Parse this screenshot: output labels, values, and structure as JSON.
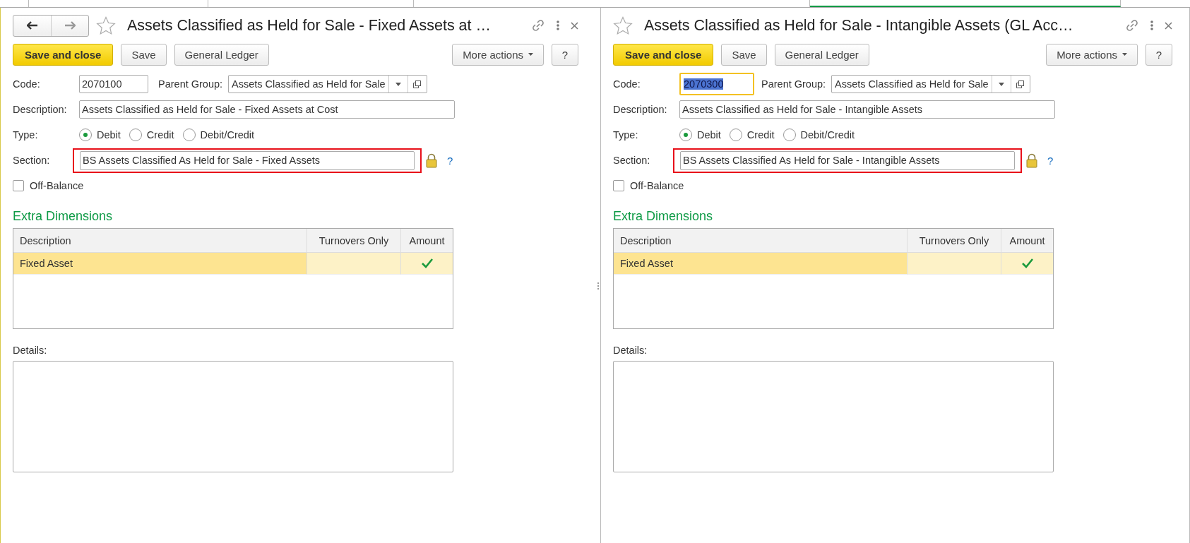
{
  "forms": [
    {
      "nav_buttons": true,
      "favorite": false,
      "title": "Assets Classified as Held for Sale - Fixed Assets at …",
      "buttons": [
        {
          "label": "Save and close",
          "kind": "primary"
        },
        {
          "label": "Save",
          "kind": "normal"
        },
        {
          "label": "General Ledger",
          "kind": "normal"
        },
        {
          "label": "More actions",
          "kind": "menu"
        },
        {
          "label": "?",
          "kind": "help"
        }
      ],
      "code": {
        "label": "Code:",
        "value": "2070100",
        "focused": false
      },
      "parent_group": {
        "label": "Parent Group:",
        "value": "Assets Classified as Held for Sale"
      },
      "description": {
        "label": "Description:",
        "value": "Assets Classified as Held for Sale - Fixed Assets at Cost"
      },
      "type": {
        "label": "Type:",
        "options": [
          {
            "label": "Debit",
            "selected": true
          },
          {
            "label": "Credit",
            "selected": false
          },
          {
            "label": "Debit/Credit",
            "selected": false
          }
        ]
      },
      "section": {
        "label": "Section:",
        "value": "BS Assets Classified As Held for Sale - Fixed Assets",
        "highlighted": true,
        "locked": true,
        "help": "?"
      },
      "off_balance": {
        "label": "Off-Balance",
        "checked": false
      },
      "extra_dimensions": {
        "title": "Extra Dimensions",
        "columns": [
          "Description",
          "Turnovers Only",
          "Amount"
        ],
        "rows": [
          {
            "description": "Fixed Asset",
            "turnovers_only": false,
            "amount": true,
            "selected": true
          }
        ]
      },
      "details": {
        "label": "Details:"
      }
    },
    {
      "nav_buttons": false,
      "favorite": false,
      "title": "Assets Classified as Held for Sale - Intangible Assets (GL Acc…",
      "buttons": [
        {
          "label": "Save and close",
          "kind": "primary"
        },
        {
          "label": "Save",
          "kind": "normal"
        },
        {
          "label": "General Ledger",
          "kind": "normal"
        },
        {
          "label": "More actions",
          "kind": "menu"
        },
        {
          "label": "?",
          "kind": "help"
        }
      ],
      "code": {
        "label": "Code:",
        "value": "2070300",
        "focused": true
      },
      "parent_group": {
        "label": "Parent Group:",
        "value": "Assets Classified as Held for Sale"
      },
      "description": {
        "label": "Description:",
        "value": "Assets Classified as Held for Sale - Intangible Assets"
      },
      "type": {
        "label": "Type:",
        "options": [
          {
            "label": "Debit",
            "selected": true
          },
          {
            "label": "Credit",
            "selected": false
          },
          {
            "label": "Debit/Credit",
            "selected": false
          }
        ]
      },
      "section": {
        "label": "Section:",
        "value": "BS Assets Classified As Held for Sale - Intangible Assets",
        "highlighted": true,
        "locked": true,
        "help": "?"
      },
      "off_balance": {
        "label": "Off-Balance",
        "checked": false
      },
      "extra_dimensions": {
        "title": "Extra Dimensions",
        "columns": [
          "Description",
          "Turnovers Only",
          "Amount"
        ],
        "rows": [
          {
            "description": "Fixed Asset",
            "turnovers_only": false,
            "amount": true,
            "selected": true
          }
        ]
      },
      "details": {
        "label": "Details:"
      }
    }
  ]
}
